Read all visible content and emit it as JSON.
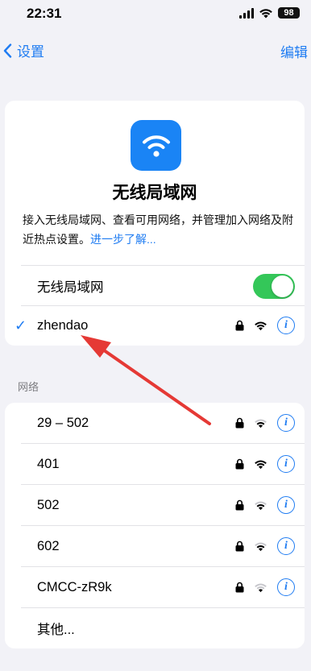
{
  "status_bar": {
    "time": "22:31",
    "battery": "98"
  },
  "nav": {
    "back_label": "设置",
    "edit_label": "编辑"
  },
  "header": {
    "title": "无线局域网",
    "description": "接入无线局域网、查看可用网络，并管理加入网络及附近热点设置。",
    "learn_more": "进一步了解..."
  },
  "wifi_toggle": {
    "label": "无线局域网",
    "on": true
  },
  "connected": {
    "name": "zhendao"
  },
  "networks_header": "网络",
  "networks": [
    {
      "name": "29 – 502"
    },
    {
      "name": "401"
    },
    {
      "name": "502"
    },
    {
      "name": "602"
    },
    {
      "name": "CMCC-zR9k"
    }
  ],
  "other_label": "其他...",
  "colors": {
    "accent": "#1f7cf2",
    "toggle_on": "#34c759",
    "arrow": "#e53935"
  }
}
